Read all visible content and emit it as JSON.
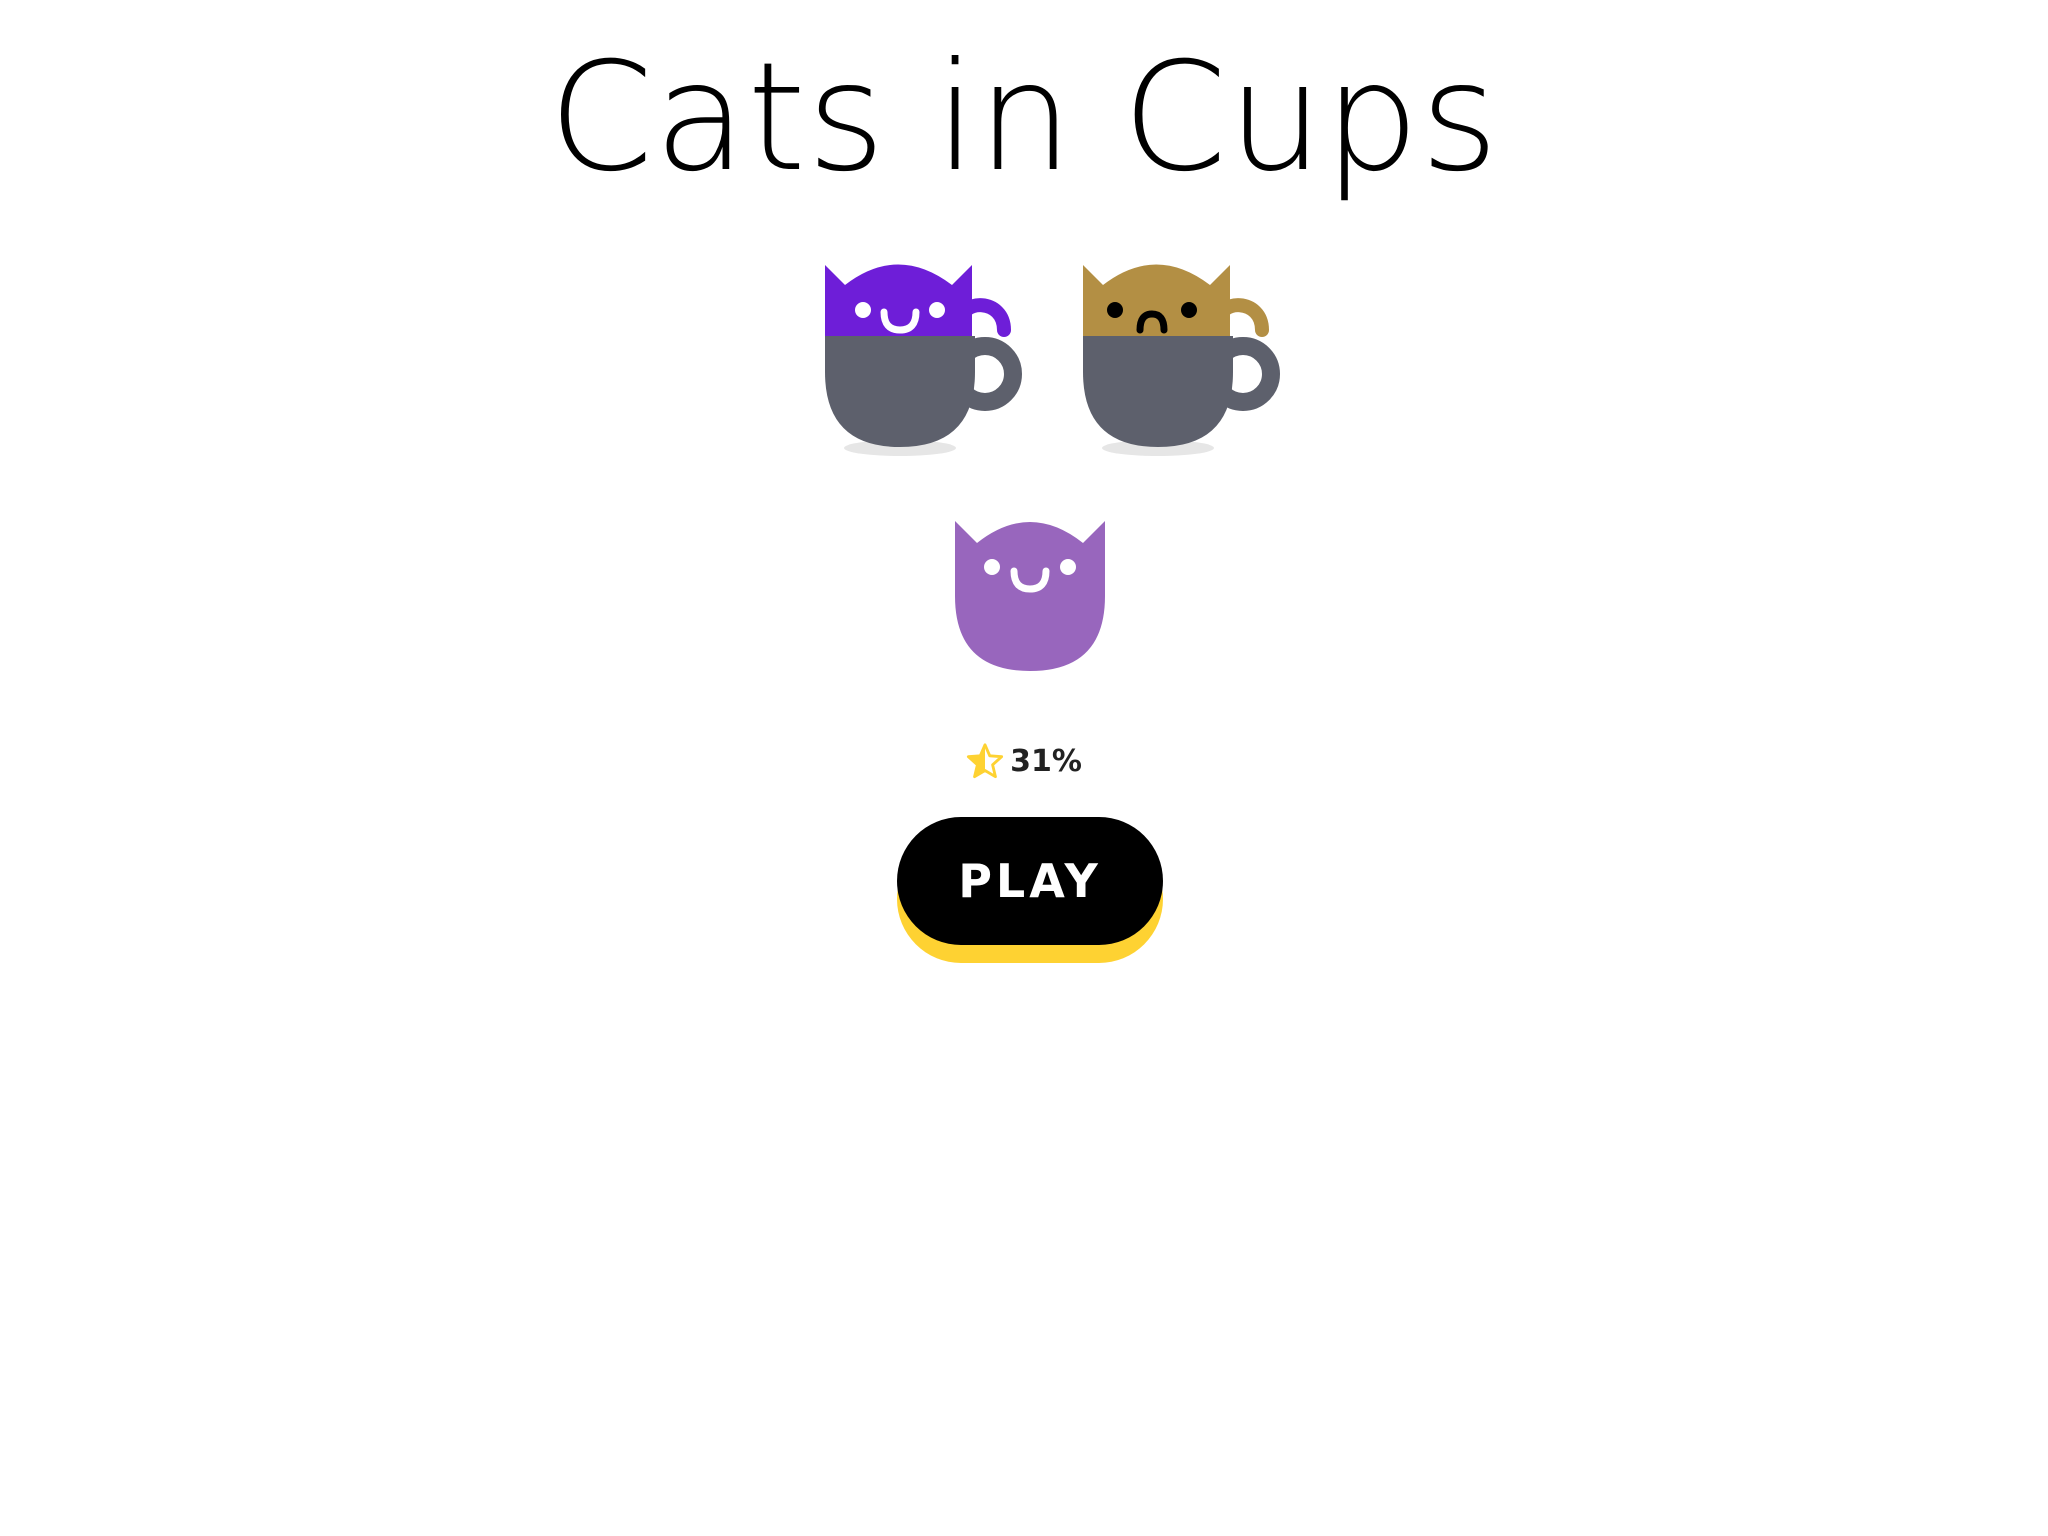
{
  "title": "Cats in Cups",
  "cats": [
    {
      "name": "purple-cat-in-cup",
      "color": "#6e1ed8",
      "mood": "happy",
      "in_cup": true
    },
    {
      "name": "tan-cat-in-cup",
      "color": "#b38f44",
      "mood": "sad",
      "in_cup": true
    },
    {
      "name": "lavender-cat",
      "color": "#9866bd",
      "mood": "happy",
      "in_cup": false
    }
  ],
  "cup_color": "#5d606c",
  "progress": {
    "icon": "half-star-icon",
    "label": "31%",
    "value": 0.31,
    "color": "#fed232"
  },
  "play_button": {
    "label": "PLAY",
    "color": "#000000",
    "shadow_color": "#fed232"
  }
}
